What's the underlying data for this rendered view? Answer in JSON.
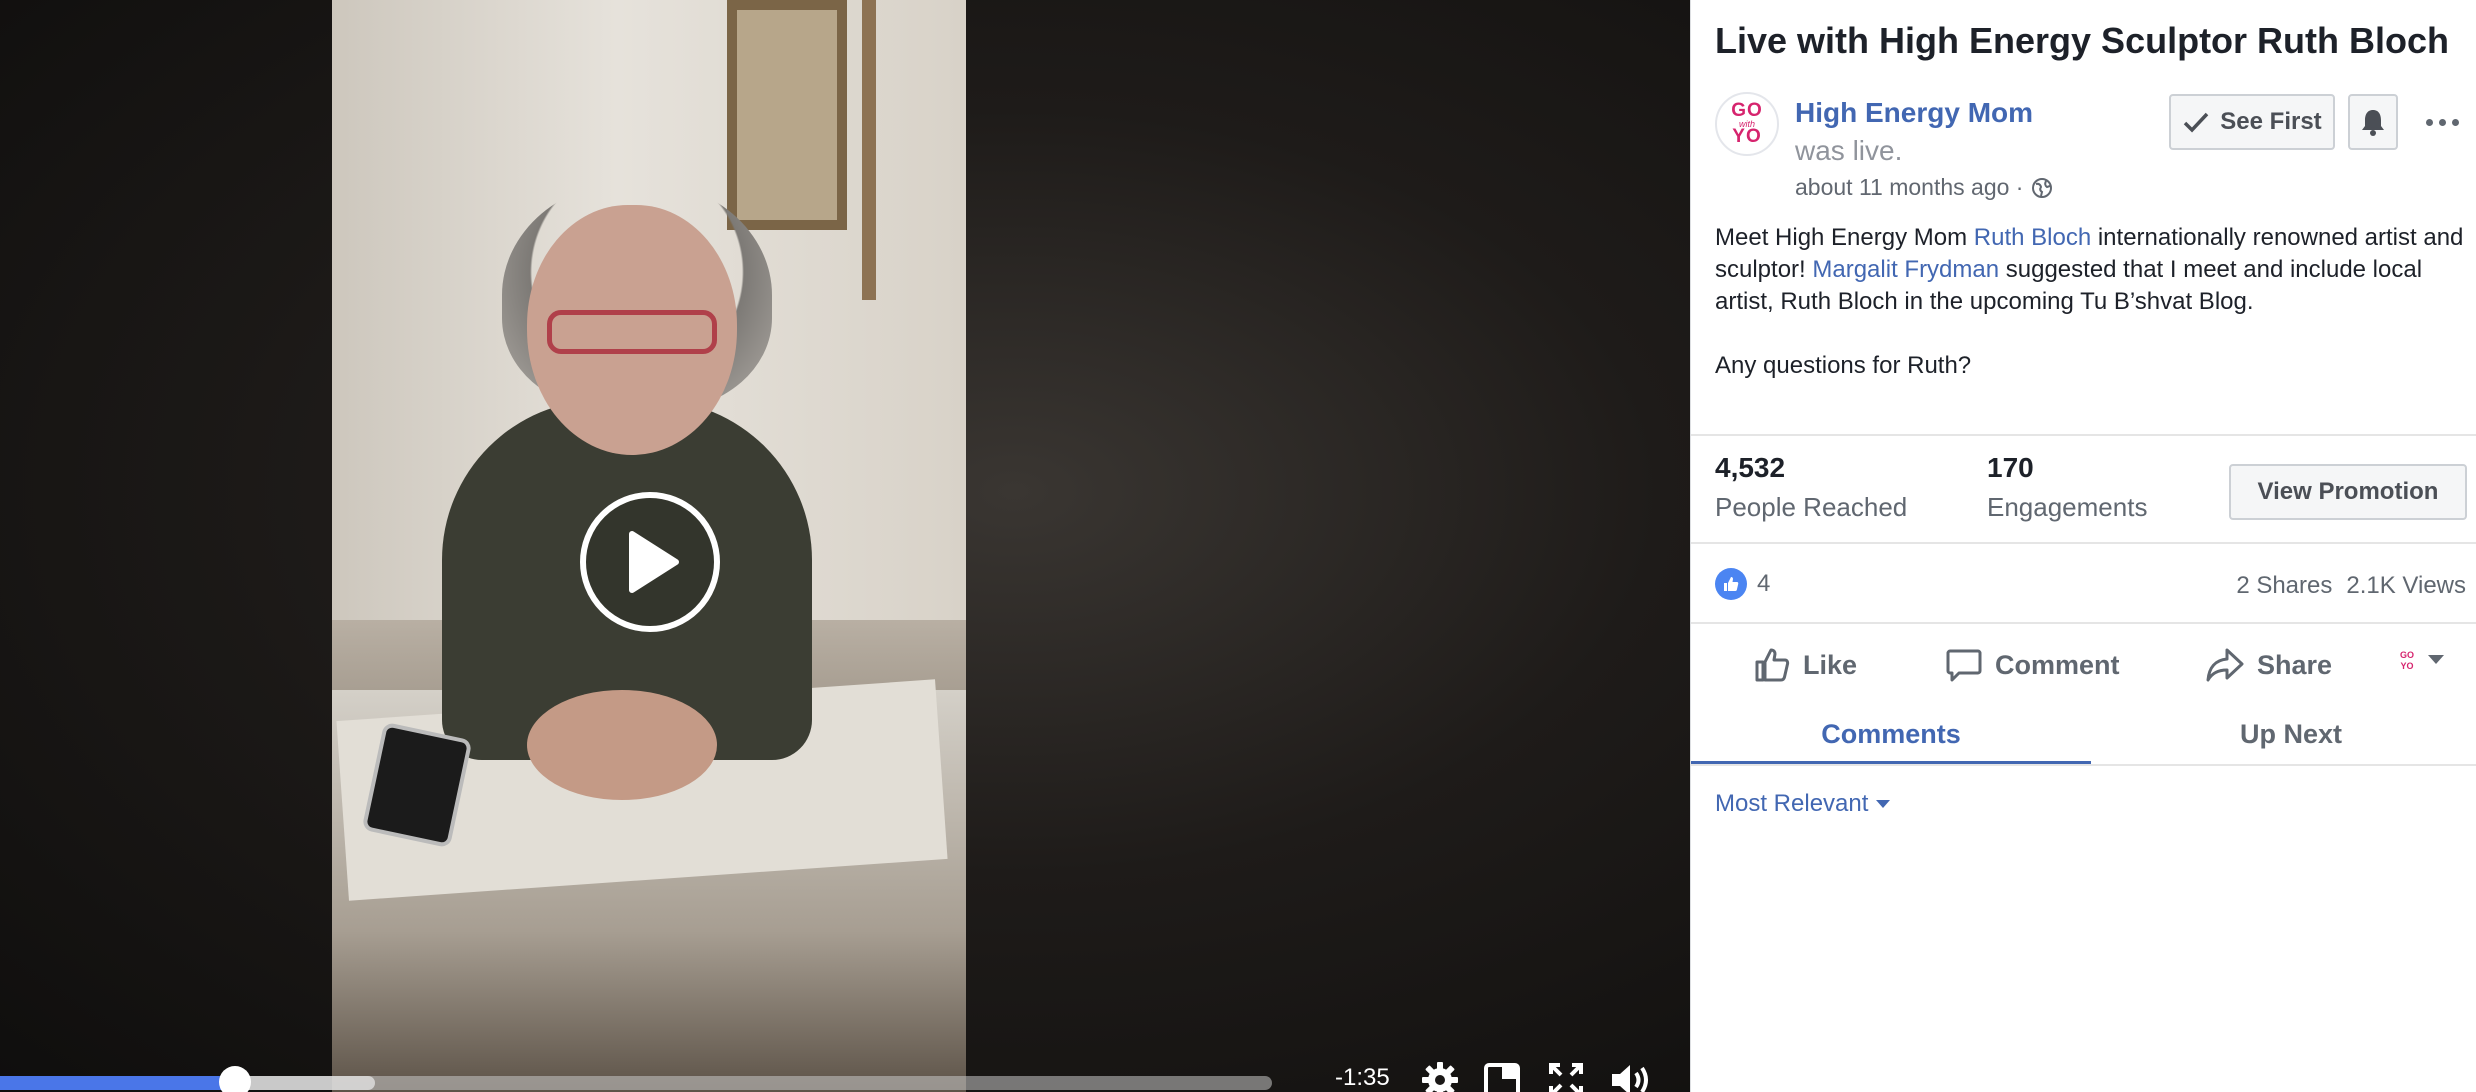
{
  "video": {
    "time_remaining": "-1:35",
    "progress_fraction": 0.185,
    "buffered_fraction": 0.295
  },
  "post": {
    "title": "Live with High Energy Sculptor Ruth Bloch",
    "avatar_text_top": "GO",
    "avatar_text_mid": "with",
    "avatar_text_bottom": "YO",
    "author": "High Energy Mom",
    "author_suffix": "was live.",
    "time": "about 11 months ago ·",
    "see_first_label": "See First",
    "body": {
      "p1_a": "Meet High Energy Mom ",
      "p1_link1": "Ruth Bloch",
      "p1_b": " internationally renowned artist and sculptor! ",
      "p1_link2": "Margalit Frydman",
      "p1_c": " suggested that I meet and include local artist, Ruth Bloch in the upcoming Tu B’shvat Blog.",
      "p2": "Any questions for Ruth?"
    }
  },
  "insights": {
    "people_reached_value": "4,532",
    "people_reached_label": "People Reached",
    "engagements_value": "170",
    "engagements_label": "Engagements",
    "view_promotion_label": "View Promotion"
  },
  "reactions": {
    "like_count": "4",
    "shares": "2 Shares",
    "views": "2.1K Views"
  },
  "actions": {
    "like": "Like",
    "comment": "Comment",
    "share": "Share"
  },
  "tabs": {
    "comments": "Comments",
    "up_next": "Up Next"
  },
  "comments": {
    "sort_label": "Most Relevant"
  },
  "colors": {
    "brand_blue": "#4267b2",
    "progress_blue": "#4a76e8",
    "avatar_pink": "#d6246e"
  },
  "icons": [
    "play-icon",
    "settings-gear-icon",
    "picture-in-picture-icon",
    "fullscreen-icon",
    "volume-icon",
    "checkmark-icon",
    "bell-icon",
    "more-dots-icon",
    "globe-icon",
    "like-thumb-icon",
    "comment-bubble-icon",
    "share-arrow-icon",
    "reaction-selector-icon",
    "caret-down-icon"
  ]
}
